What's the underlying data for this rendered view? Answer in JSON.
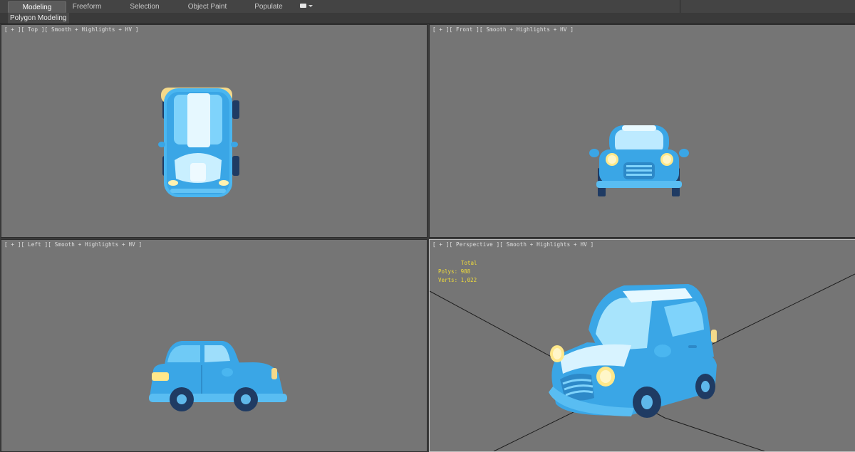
{
  "ribbon": {
    "tabs": [
      {
        "label": "Modeling",
        "active": true
      },
      {
        "label": "Freeform",
        "active": false
      },
      {
        "label": "Selection",
        "active": false
      },
      {
        "label": "Object Paint",
        "active": false
      },
      {
        "label": "Populate",
        "active": false
      }
    ],
    "dropdown_icon": "panel-toggle-icon"
  },
  "panel": {
    "label": "Polygon Modeling"
  },
  "viewports": {
    "top": {
      "label": "[ + ][ Top ][ Smooth + Highlights + HV ]"
    },
    "front": {
      "label": "[ + ][ Front ][ Smooth + Highlights + HV ]"
    },
    "left": {
      "label": "[ + ][ Left ][ Smooth + Highlights + HV ]"
    },
    "perspective": {
      "label": "[ + ][ Perspective ][ Smooth + Highlights + HV ]",
      "stats": {
        "total": "Total",
        "polys_label": "Polys:",
        "polys_value": "988",
        "verts_label": "Verts:",
        "verts_value": "1,022"
      }
    }
  },
  "colors": {
    "viewport_bg": "#757575",
    "car_body": "#3aa6e6",
    "car_highlight": "#d8f3ff",
    "headlight": "#ffe88a",
    "stats_text": "#f0dc3a"
  }
}
